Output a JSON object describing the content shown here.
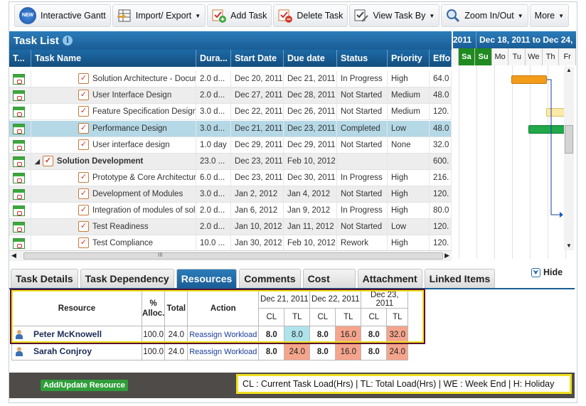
{
  "toolbar": {
    "new_badge": "NEW",
    "interactive_gantt": "Interactive Gantt",
    "import_export": "Import/ Export",
    "add_task": "Add Task",
    "delete_task": "Delete Task",
    "view_task_by": "View Task By",
    "zoom": "Zoom In/Out",
    "more": "More"
  },
  "task_list": {
    "title": "Task List",
    "columns": [
      "T...",
      "Task Name",
      "Dura...",
      "Start Date",
      "Due date",
      "Status",
      "Priority",
      "Effo"
    ],
    "rows": [
      {
        "name": "Solution Architecture - Document",
        "duration": "2.0 d...",
        "start": "Dec 20, 2011",
        "due": "Dec 21, 2011",
        "status": "In Progress",
        "priority": "High",
        "effort": "64.0"
      },
      {
        "name": "User Interface Design",
        "duration": "2.0 d...",
        "start": "Dec 27, 2011",
        "due": "Dec 28, 2011",
        "status": "Not Started",
        "priority": "Medium",
        "effort": "48.0"
      },
      {
        "name": "Feature Specification Design",
        "duration": "3.0 d...",
        "start": "Dec 22, 2011",
        "due": "Dec 26, 2011",
        "status": "Not Started",
        "priority": "Medium",
        "effort": "120."
      },
      {
        "name": "Performance Design",
        "duration": "3.0 d...",
        "start": "Dec 21, 2011",
        "due": "Dec 23, 2011",
        "status": "Completed",
        "priority": "Low",
        "effort": "48.0"
      },
      {
        "name": "User interface design",
        "duration": "1.0 day",
        "start": "Dec 29, 2011",
        "due": "Dec 29, 2011",
        "status": "Not Started",
        "priority": "None",
        "effort": "32.0"
      },
      {
        "name": "Solution Development",
        "duration": "23.0 ...",
        "start": "Dec 23, 2011",
        "due": "Feb 10, 2012",
        "status": "",
        "priority": "",
        "effort": "600."
      },
      {
        "name": "Prototype & Core Architecture",
        "duration": "6.0 d...",
        "start": "Dec 23, 2011",
        "due": "Dec 30, 2011",
        "status": "In Progress",
        "priority": "High",
        "effort": "216."
      },
      {
        "name": "Development of Modules",
        "duration": "3.0 d...",
        "start": "Jan 2, 2012",
        "due": "Jan 4, 2012",
        "status": "Not Started",
        "priority": "High",
        "effort": "120."
      },
      {
        "name": "Integration of modules of solution",
        "duration": "2.0 d...",
        "start": "Jan 6, 2012",
        "due": "Jan 9, 2012",
        "status": "In Progress",
        "priority": "High",
        "effort": "80.0"
      },
      {
        "name": "Test Readiness",
        "duration": "2.0 d...",
        "start": "Jan 10, 2012",
        "due": "Jan 11, 2012",
        "status": "Not Started",
        "priority": "Low",
        "effort": "120."
      },
      {
        "name": "Test Compliance",
        "duration": "10.0 ...",
        "start": "Jan 30, 2012",
        "due": "Feb 10, 2012",
        "status": "Rework",
        "priority": "High",
        "effort": "120."
      }
    ],
    "scroll_marker": "III"
  },
  "gantt": {
    "year_fragment": "2011",
    "week_label": "Dec 18, 2011 to Dec 24,",
    "days": [
      "Sa",
      "Su",
      "Mo",
      "Tu",
      "We",
      "Th",
      "Fr"
    ]
  },
  "tabs": [
    "Task Details",
    "Task Dependency",
    "Resources",
    "Comments",
    "Cost",
    "Attachment",
    "Linked Items"
  ],
  "hide_label": "Hide",
  "resources": {
    "headers": {
      "resource": "Resource",
      "alloc": "% Alloc.",
      "total": "Total",
      "action": "Action",
      "cl": "CL",
      "tl": "TL"
    },
    "dates": [
      "Dec 21, 2011",
      "Dec 22, 2011",
      "Dec 23, 2011"
    ],
    "rows": [
      {
        "name": "Peter McKnowell",
        "alloc": "100.0",
        "total": "24.0",
        "action": "Reassign Workload",
        "loads": [
          "8.0",
          "8.0",
          "8.0",
          "16.0",
          "8.0",
          "32.0"
        ]
      },
      {
        "name": "Sarah Conjroy",
        "alloc": "100.0",
        "total": "24.0",
        "action": "Reassign Workload",
        "loads": [
          "8.0",
          "24.0",
          "8.0",
          "16.0",
          "8.0",
          "24.0"
        ]
      }
    ]
  },
  "add_update_button": "Add/Update Resource",
  "legend": "CL : Current Task Load(Hrs) | TL: Total Load(Hrs) | WE : Week End | H: Holiday"
}
